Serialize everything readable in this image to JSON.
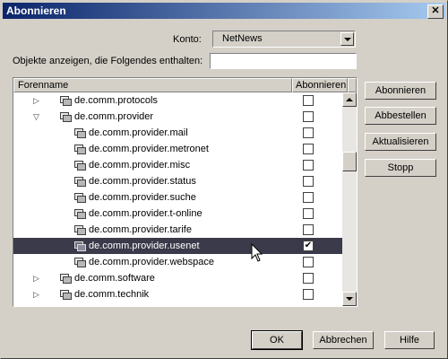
{
  "window": {
    "title": "Abonnieren",
    "close_glyph": "✕"
  },
  "account": {
    "label": "Konto:",
    "value": "NetNews"
  },
  "filter": {
    "label": "Objekte anzeigen, die Folgendes enthalten:",
    "value": ""
  },
  "table": {
    "col_name": "Forenname",
    "col_subscribe": "Abonnieren",
    "rows": [
      {
        "name": "de.comm.protocols",
        "checked": false,
        "level": 1,
        "twisty": "collapsed"
      },
      {
        "name": "de.comm.provider",
        "checked": false,
        "level": 1,
        "twisty": "expanded"
      },
      {
        "name": "de.comm.provider.mail",
        "checked": false,
        "level": 2,
        "twisty": "none"
      },
      {
        "name": "de.comm.provider.metronet",
        "checked": false,
        "level": 2,
        "twisty": "none"
      },
      {
        "name": "de.comm.provider.misc",
        "checked": false,
        "level": 2,
        "twisty": "none"
      },
      {
        "name": "de.comm.provider.status",
        "checked": false,
        "level": 2,
        "twisty": "none"
      },
      {
        "name": "de.comm.provider.suche",
        "checked": false,
        "level": 2,
        "twisty": "none"
      },
      {
        "name": "de.comm.provider.t-online",
        "checked": false,
        "level": 2,
        "twisty": "none"
      },
      {
        "name": "de.comm.provider.tarife",
        "checked": false,
        "level": 2,
        "twisty": "none"
      },
      {
        "name": "de.comm.provider.usenet",
        "checked": true,
        "level": 2,
        "twisty": "none",
        "selected": true
      },
      {
        "name": "de.comm.provider.webspace",
        "checked": false,
        "level": 2,
        "twisty": "none"
      },
      {
        "name": "de.comm.software",
        "checked": false,
        "level": 1,
        "twisty": "collapsed"
      },
      {
        "name": "de.comm.technik",
        "checked": false,
        "level": 1,
        "twisty": "collapsed"
      }
    ]
  },
  "buttons": {
    "subscribe": "Abonnieren",
    "unsubscribe": "Abbestellen",
    "refresh": "Aktualisieren",
    "stop": "Stopp",
    "ok": "OK",
    "cancel": "Abbrechen",
    "help": "Hilfe"
  },
  "colors": {
    "title_start": "#0a246a",
    "title_end": "#a6caf0",
    "selection": "#3a3a4a",
    "face": "#d4d0c8"
  }
}
